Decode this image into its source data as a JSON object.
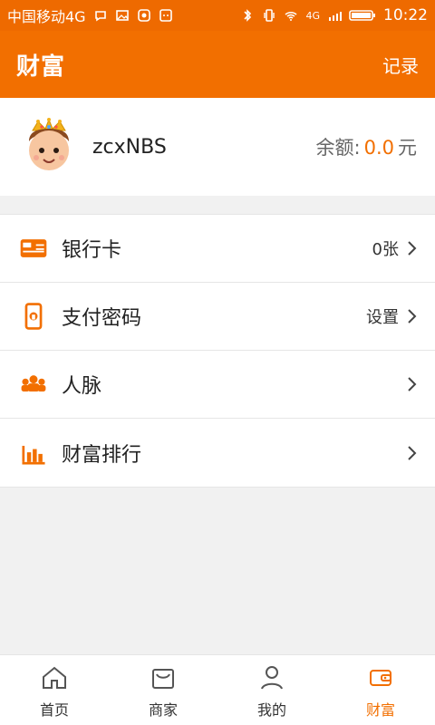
{
  "statusbar": {
    "carrier": "中国移动4G",
    "network_type": "4G",
    "time": "10:22",
    "icons": [
      "chat-icon",
      "image-icon",
      "wechat-icon",
      "cat-icon",
      "bluetooth-icon",
      "vibrate-icon",
      "wifi-icon",
      "signal-icon",
      "battery-icon"
    ]
  },
  "appbar": {
    "title": "财富",
    "record": "记录"
  },
  "profile": {
    "username": "zcxNBS",
    "balance_label": "余额:",
    "balance_value": "0.0",
    "balance_unit": "元"
  },
  "menu": {
    "items": [
      {
        "label": "银行卡",
        "value": "0张",
        "icon": "bank-card-icon"
      },
      {
        "label": "支付密码",
        "value": "设置",
        "icon": "phone-lock-icon"
      },
      {
        "label": "人脉",
        "value": "",
        "icon": "people-icon"
      },
      {
        "label": "财富排行",
        "value": "",
        "icon": "bar-chart-icon"
      }
    ]
  },
  "bottom_nav": {
    "items": [
      {
        "label": "首页",
        "icon": "home-icon"
      },
      {
        "label": "商家",
        "icon": "shop-icon"
      },
      {
        "label": "我的",
        "icon": "user-icon"
      },
      {
        "label": "财富",
        "icon": "wallet-icon",
        "active": true
      }
    ]
  },
  "colors": {
    "primary": "#f26f00",
    "background": "#f1f1f1",
    "text": "#222222"
  }
}
